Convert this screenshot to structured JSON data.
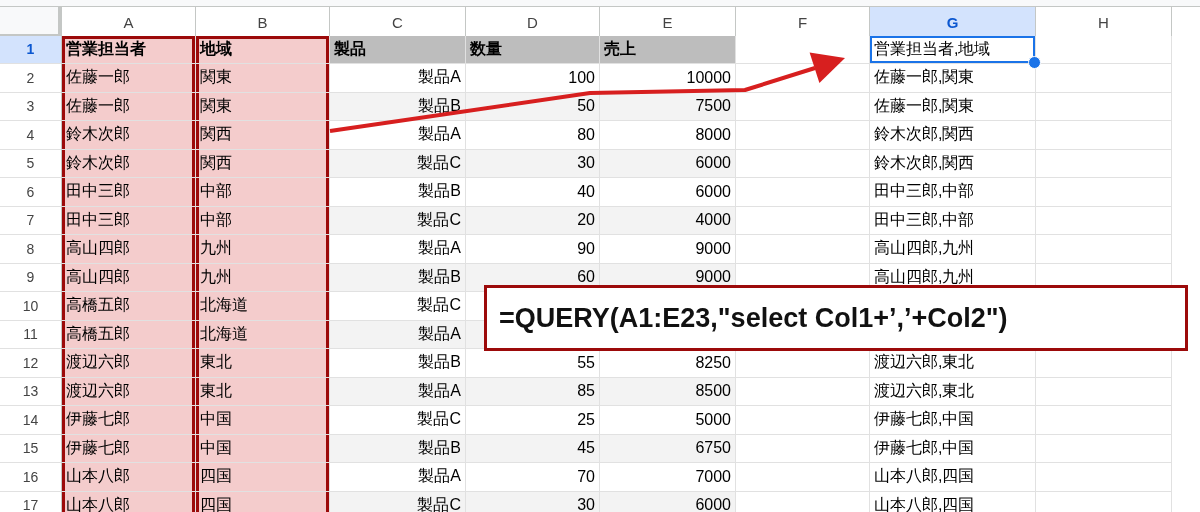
{
  "columns": [
    {
      "label": "A",
      "selected": false,
      "highlighted": true
    },
    {
      "label": "B",
      "selected": false,
      "highlighted": true
    },
    {
      "label": "C",
      "selected": false,
      "highlighted": false
    },
    {
      "label": "D",
      "selected": false,
      "highlighted": false
    },
    {
      "label": "E",
      "selected": false,
      "highlighted": false
    },
    {
      "label": "F",
      "selected": false,
      "highlighted": false
    },
    {
      "label": "G",
      "selected": true,
      "highlighted": false
    },
    {
      "label": "H",
      "selected": false,
      "highlighted": false
    }
  ],
  "rows": [
    {
      "number": "1",
      "selected": true,
      "kind": "header",
      "a": "営業担当者",
      "b": "地域",
      "c": "製品",
      "d": "数量",
      "e": "売上",
      "g": "営業担当者,地域"
    },
    {
      "number": "2",
      "selected": false,
      "kind": "data",
      "a": "佐藤一郎",
      "b": "関東",
      "c": "製品A",
      "d": "100",
      "e": "10000",
      "g": "佐藤一郎,関東"
    },
    {
      "number": "3",
      "selected": false,
      "kind": "data",
      "a": "佐藤一郎",
      "b": "関東",
      "c": "製品B",
      "d": "50",
      "e": "7500",
      "g": "佐藤一郎,関東"
    },
    {
      "number": "4",
      "selected": false,
      "kind": "data",
      "a": "鈴木次郎",
      "b": "関西",
      "c": "製品A",
      "d": "80",
      "e": "8000",
      "g": "鈴木次郎,関西"
    },
    {
      "number": "5",
      "selected": false,
      "kind": "data",
      "a": "鈴木次郎",
      "b": "関西",
      "c": "製品C",
      "d": "30",
      "e": "6000",
      "g": "鈴木次郎,関西"
    },
    {
      "number": "6",
      "selected": false,
      "kind": "data",
      "a": "田中三郎",
      "b": "中部",
      "c": "製品B",
      "d": "40",
      "e": "6000",
      "g": "田中三郎,中部"
    },
    {
      "number": "7",
      "selected": false,
      "kind": "data",
      "a": "田中三郎",
      "b": "中部",
      "c": "製品C",
      "d": "20",
      "e": "4000",
      "g": "田中三郎,中部"
    },
    {
      "number": "8",
      "selected": false,
      "kind": "data",
      "a": "高山四郎",
      "b": "九州",
      "c": "製品A",
      "d": "90",
      "e": "9000",
      "g": "高山四郎,九州"
    },
    {
      "number": "9",
      "selected": false,
      "kind": "data",
      "a": "高山四郎",
      "b": "九州",
      "c": "製品B",
      "d": "60",
      "e": "9000",
      "g": "高山四郎,九州"
    },
    {
      "number": "10",
      "selected": false,
      "kind": "data",
      "a": "高橋五郎",
      "b": "北海道",
      "c": "製品C"
    },
    {
      "number": "11",
      "selected": false,
      "kind": "data",
      "a": "高橋五郎",
      "b": "北海道",
      "c": "製品A"
    },
    {
      "number": "12",
      "selected": false,
      "kind": "data",
      "a": "渡辺六郎",
      "b": "東北",
      "c": "製品B",
      "d": "55",
      "e": "8250",
      "g": "渡辺六郎,東北"
    },
    {
      "number": "13",
      "selected": false,
      "kind": "data",
      "a": "渡辺六郎",
      "b": "東北",
      "c": "製品A",
      "d": "85",
      "e": "8500",
      "g": "渡辺六郎,東北"
    },
    {
      "number": "14",
      "selected": false,
      "kind": "data",
      "a": "伊藤七郎",
      "b": "中国",
      "c": "製品C",
      "d": "25",
      "e": "5000",
      "g": "伊藤七郎,中国"
    },
    {
      "number": "15",
      "selected": false,
      "kind": "data",
      "a": "伊藤七郎",
      "b": "中国",
      "c": "製品B",
      "d": "45",
      "e": "6750",
      "g": "伊藤七郎,中国"
    },
    {
      "number": "16",
      "selected": false,
      "kind": "data",
      "a": "山本八郎",
      "b": "四国",
      "c": "製品A",
      "d": "70",
      "e": "7000",
      "g": "山本八郎,四国"
    },
    {
      "number": "17",
      "selected": false,
      "kind": "data",
      "a": "山本八郎",
      "b": "四国",
      "c": "製品C",
      "d": "30",
      "e": "6000",
      "g": "山本八郎,四国"
    }
  ],
  "callout": {
    "formula": "=QUERY(A1:E23,\"select Col1+’,’+Col2\")"
  }
}
